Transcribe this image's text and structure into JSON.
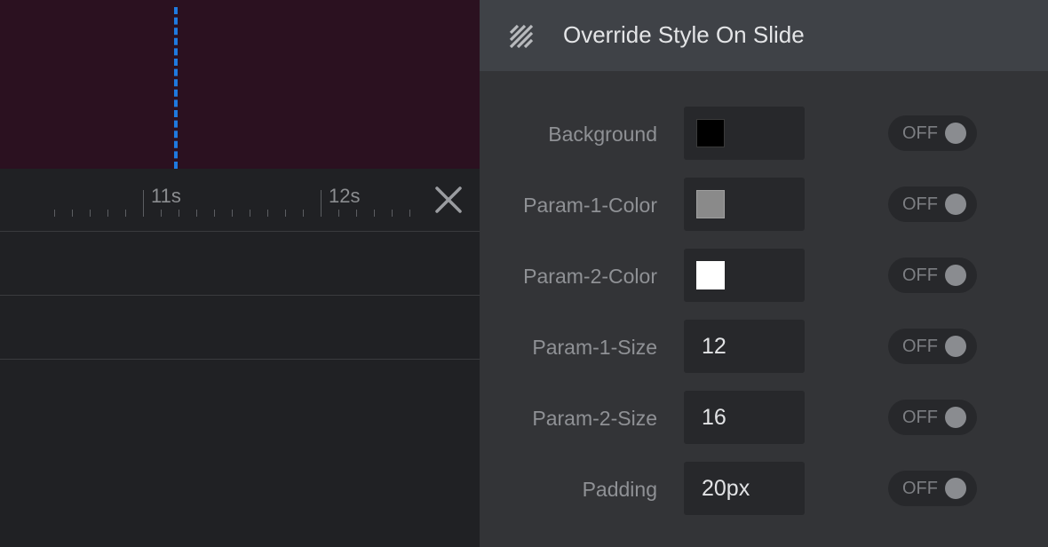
{
  "timeline": {
    "partial_label": "s",
    "labels": [
      "11s",
      "12s"
    ]
  },
  "panel": {
    "title": "Override Style On Slide",
    "rows": [
      {
        "label": "Background",
        "type": "color",
        "color": "#000000"
      },
      {
        "label": "Param-1-Color",
        "type": "color",
        "color": "#8a8a8a"
      },
      {
        "label": "Param-2-Color",
        "type": "color",
        "color": "#ffffff"
      },
      {
        "label": "Param-1-Size",
        "type": "text",
        "value": "12"
      },
      {
        "label": "Param-2-Size",
        "type": "text",
        "value": "16"
      },
      {
        "label": "Padding",
        "type": "text",
        "value": "20px"
      }
    ],
    "toggle_label": "OFF"
  },
  "icons": {
    "header": "striped-square-icon",
    "close": "close-icon"
  },
  "colors": {
    "playhead": "#1f7ae0",
    "preview_bg": "#2b1120",
    "panel_bg": "#333437",
    "header_bg": "#3f4247"
  }
}
